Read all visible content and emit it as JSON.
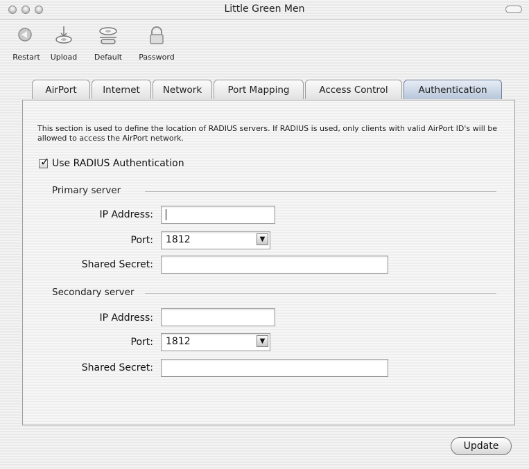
{
  "window": {
    "title": "Little Green Men"
  },
  "toolbar": {
    "items": [
      {
        "label": "Restart",
        "icon": "restart-icon"
      },
      {
        "label": "Upload",
        "icon": "upload-icon"
      },
      {
        "label": "Default",
        "icon": "default-icon"
      },
      {
        "label": "Password",
        "icon": "lock-icon"
      }
    ]
  },
  "tabs": [
    {
      "label": "AirPort",
      "active": false
    },
    {
      "label": "Internet",
      "active": false
    },
    {
      "label": "Network",
      "active": false
    },
    {
      "label": "Port Mapping",
      "active": false
    },
    {
      "label": "Access Control",
      "active": false
    },
    {
      "label": "Authentication",
      "active": true
    }
  ],
  "panel": {
    "description": "This section is used to define the location of RADIUS servers. If RADIUS is used, only clients with valid AirPort ID's will be allowed to access the AirPort network.",
    "use_radius": {
      "label": "Use RADIUS Authentication",
      "checked": true
    }
  },
  "primary": {
    "heading": "Primary server",
    "ip_label": "IP Address:",
    "ip_value": "",
    "port_label": "Port:",
    "port_value": "1812",
    "secret_label": "Shared Secret:",
    "secret_value": ""
  },
  "secondary": {
    "heading": "Secondary server",
    "ip_label": "IP Address:",
    "ip_value": "",
    "port_label": "Port:",
    "port_value": "1812",
    "secret_label": "Shared Secret:",
    "secret_value": ""
  },
  "actions": {
    "update_label": "Update"
  },
  "colors": {
    "active_tab": "#b7c6da",
    "window_bg": "#efefef"
  }
}
